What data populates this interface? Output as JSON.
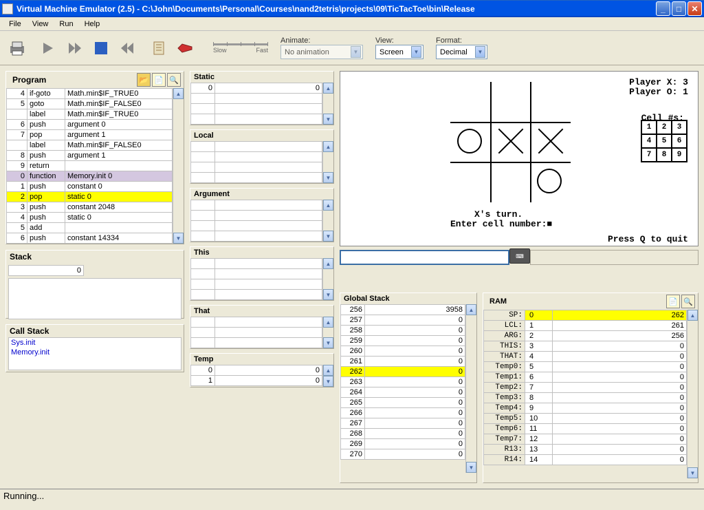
{
  "window": {
    "title": "Virtual Machine Emulator (2.5) - C:\\John\\Documents\\Personal\\Courses\\nand2tetris\\projects\\09\\TicTacToe\\bin\\Release"
  },
  "menus": [
    "File",
    "View",
    "Run",
    "Help"
  ],
  "toolbar": {
    "animate_label": "Animate:",
    "animate_value": "No animation",
    "view_label": "View:",
    "view_value": "Screen",
    "format_label": "Format:",
    "format_value": "Decimal",
    "slow": "Slow",
    "fast": "Fast"
  },
  "program": {
    "title": "Program",
    "rows": [
      {
        "n": "4",
        "op": "if-goto",
        "arg": "Math.min$IF_TRUE0",
        "hl": ""
      },
      {
        "n": "5",
        "op": "goto",
        "arg": "Math.min$IF_FALSE0",
        "hl": ""
      },
      {
        "n": "",
        "op": "label",
        "arg": "Math.min$IF_TRUE0",
        "hl": ""
      },
      {
        "n": "6",
        "op": "push",
        "arg": "argument 0",
        "hl": ""
      },
      {
        "n": "7",
        "op": "pop",
        "arg": "argument 1",
        "hl": ""
      },
      {
        "n": "",
        "op": "label",
        "arg": "Math.min$IF_FALSE0",
        "hl": ""
      },
      {
        "n": "8",
        "op": "push",
        "arg": "argument 1",
        "hl": ""
      },
      {
        "n": "9",
        "op": "return",
        "arg": "",
        "hl": ""
      },
      {
        "n": "0",
        "op": "function",
        "arg": "Memory.init 0",
        "hl": "purple"
      },
      {
        "n": "1",
        "op": "push",
        "arg": "constant 0",
        "hl": ""
      },
      {
        "n": "2",
        "op": "pop",
        "arg": "static 0",
        "hl": "yellow"
      },
      {
        "n": "3",
        "op": "push",
        "arg": "constant 2048",
        "hl": ""
      },
      {
        "n": "4",
        "op": "push",
        "arg": "static 0",
        "hl": ""
      },
      {
        "n": "5",
        "op": "add",
        "arg": "",
        "hl": ""
      },
      {
        "n": "6",
        "op": "push",
        "arg": "constant 14334",
        "hl": ""
      }
    ]
  },
  "stack": {
    "title": "Stack",
    "value": "0"
  },
  "callstack": {
    "title": "Call Stack",
    "items": [
      "Sys.init",
      "Memory.init"
    ]
  },
  "mem_segments": {
    "static": {
      "title": "Static",
      "rows": [
        [
          "0",
          "0"
        ],
        [
          "",
          ""
        ],
        [
          "",
          ""
        ],
        [
          "",
          ""
        ]
      ]
    },
    "local": {
      "title": "Local",
      "rows": [
        [
          "",
          ""
        ],
        [
          "",
          ""
        ],
        [
          "",
          ""
        ],
        [
          "",
          ""
        ]
      ]
    },
    "argument": {
      "title": "Argument",
      "rows": [
        [
          "",
          ""
        ],
        [
          "",
          ""
        ],
        [
          "",
          ""
        ],
        [
          "",
          ""
        ]
      ]
    },
    "this": {
      "title": "This",
      "rows": [
        [
          "",
          ""
        ],
        [
          "",
          ""
        ],
        [
          "",
          ""
        ],
        [
          "",
          ""
        ]
      ]
    },
    "that": {
      "title": "That",
      "rows": [
        [
          "",
          ""
        ],
        [
          "",
          ""
        ],
        [
          "",
          ""
        ]
      ]
    },
    "temp": {
      "title": "Temp",
      "rows": [
        [
          "0",
          "0"
        ],
        [
          "1",
          "0"
        ]
      ]
    }
  },
  "screen": {
    "scoreX": "Player X: 3",
    "scoreO": "Player O: 1",
    "cellnums": "Cell #s:",
    "turn": "X's turn.",
    "prompt": "Enter cell number:■",
    "quit": "Press Q to quit"
  },
  "globalstack": {
    "title": "Global Stack",
    "rows": [
      {
        "a": "256",
        "v": "3958",
        "hl": ""
      },
      {
        "a": "257",
        "v": "0",
        "hl": ""
      },
      {
        "a": "258",
        "v": "0",
        "hl": ""
      },
      {
        "a": "259",
        "v": "0",
        "hl": ""
      },
      {
        "a": "260",
        "v": "0",
        "hl": ""
      },
      {
        "a": "261",
        "v": "0",
        "hl": ""
      },
      {
        "a": "262",
        "v": "0",
        "hl": "yellow"
      },
      {
        "a": "263",
        "v": "0",
        "hl": ""
      },
      {
        "a": "264",
        "v": "0",
        "hl": ""
      },
      {
        "a": "265",
        "v": "0",
        "hl": ""
      },
      {
        "a": "266",
        "v": "0",
        "hl": ""
      },
      {
        "a": "267",
        "v": "0",
        "hl": ""
      },
      {
        "a": "268",
        "v": "0",
        "hl": ""
      },
      {
        "a": "269",
        "v": "0",
        "hl": ""
      },
      {
        "a": "270",
        "v": "0",
        "hl": ""
      }
    ]
  },
  "ram": {
    "title": "RAM",
    "rows": [
      {
        "l": "SP:",
        "a": "0",
        "v": "262",
        "hl": "yellow"
      },
      {
        "l": "LCL:",
        "a": "1",
        "v": "261",
        "hl": ""
      },
      {
        "l": "ARG:",
        "a": "2",
        "v": "256",
        "hl": ""
      },
      {
        "l": "THIS:",
        "a": "3",
        "v": "0",
        "hl": ""
      },
      {
        "l": "THAT:",
        "a": "4",
        "v": "0",
        "hl": ""
      },
      {
        "l": "Temp0:",
        "a": "5",
        "v": "0",
        "hl": ""
      },
      {
        "l": "Temp1:",
        "a": "6",
        "v": "0",
        "hl": ""
      },
      {
        "l": "Temp2:",
        "a": "7",
        "v": "0",
        "hl": ""
      },
      {
        "l": "Temp3:",
        "a": "8",
        "v": "0",
        "hl": ""
      },
      {
        "l": "Temp4:",
        "a": "9",
        "v": "0",
        "hl": ""
      },
      {
        "l": "Temp5:",
        "a": "10",
        "v": "0",
        "hl": ""
      },
      {
        "l": "Temp6:",
        "a": "11",
        "v": "0",
        "hl": ""
      },
      {
        "l": "Temp7:",
        "a": "12",
        "v": "0",
        "hl": ""
      },
      {
        "l": "R13:",
        "a": "13",
        "v": "0",
        "hl": ""
      },
      {
        "l": "R14:",
        "a": "14",
        "v": "0",
        "hl": ""
      }
    ]
  },
  "status": "Running..."
}
